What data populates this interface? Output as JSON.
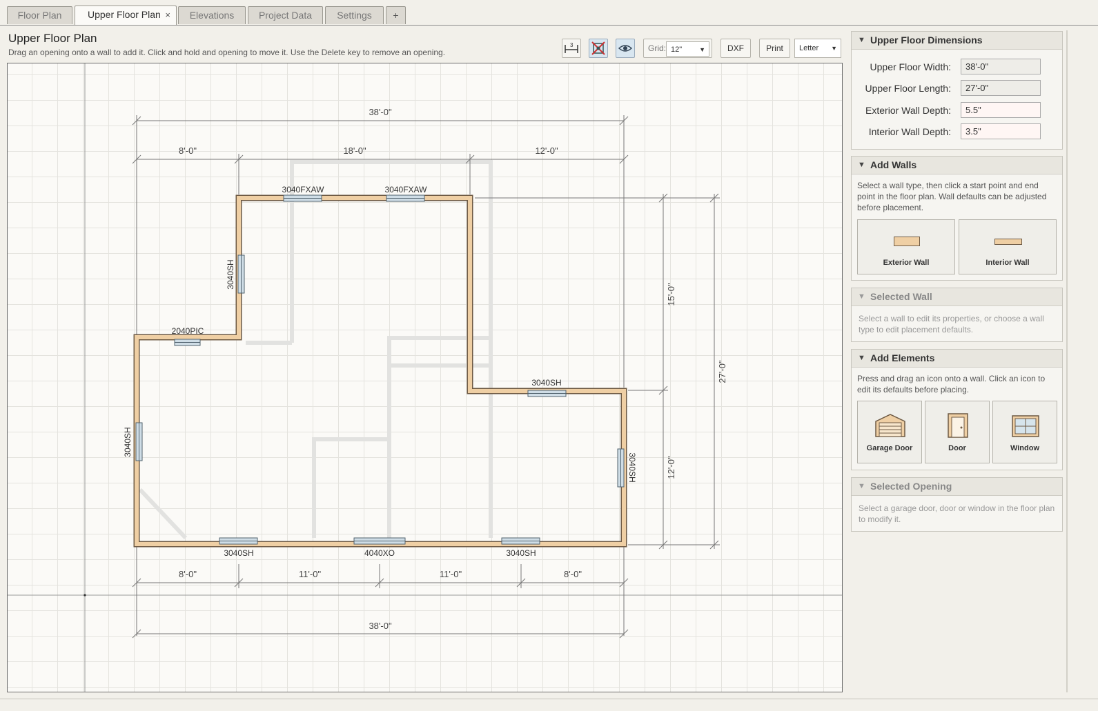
{
  "tabs": [
    {
      "label": "Floor Plan"
    },
    {
      "label": "Upper Floor Plan",
      "close": "×"
    },
    {
      "label": "Elevations"
    },
    {
      "label": "Project Data"
    },
    {
      "label": "Settings"
    },
    {
      "label": "+"
    }
  ],
  "header": {
    "title": "Upper Floor Plan",
    "instructions": "Drag an opening onto a wall to add it. Click and hold and opening to move it. Use the Delete key to remove an opening."
  },
  "toolbar": {
    "dimension_icon": "dimension-toggle-icon",
    "snap_icon": "snap-icon",
    "view_icon": "eye-icon",
    "grid_label": "Grid:",
    "grid_value": "12\"",
    "dxf_label": "DXF",
    "print_label": "Print",
    "paper_value": "Letter"
  },
  "plan": {
    "dimensions": {
      "top_overall": "38'-0\"",
      "top_left": "8'-0\"",
      "top_mid": "18'-0\"",
      "top_right": "12'-0\"",
      "bottom_overall": "38'-0\"",
      "bottom_1": "8'-0\"",
      "bottom_2": "11'-0\"",
      "bottom_3": "11'-0\"",
      "bottom_4": "8'-0\"",
      "right_upper": "15'-0\"",
      "right_lower": "12'-0\"",
      "right_overall": "27'-0\""
    },
    "openings": {
      "top_window_1": "3040FXAW",
      "top_window_2": "3040FXAW",
      "left_upper_window": "3040SH",
      "pic_window": "2040PIC",
      "left_lower_window": "3040SH",
      "step_window": "3040SH",
      "right_window": "3040SH",
      "bottom_window_1": "3040SH",
      "bottom_window_2": "4040XO",
      "bottom_window_3": "3040SH"
    }
  },
  "panels": {
    "dimensions": {
      "title": "Upper Floor Dimensions",
      "fields": [
        {
          "label": "Upper Floor Width:",
          "value": "38'-0\""
        },
        {
          "label": "Upper Floor Length:",
          "value": "27'-0\""
        },
        {
          "label": "Exterior Wall Depth:",
          "value": "5.5\""
        },
        {
          "label": "Interior Wall Depth:",
          "value": "3.5\""
        }
      ]
    },
    "add_walls": {
      "title": "Add Walls",
      "text": "Select a wall type, then click a start point and end point in the floor plan. Wall defaults can be adjusted before placement.",
      "exterior_label": "Exterior Wall",
      "interior_label": "Interior Wall"
    },
    "selected_wall": {
      "title": "Selected Wall",
      "text": "Select a wall to edit its properties, or choose a wall type to edit placement defaults."
    },
    "add_elements": {
      "title": "Add Elements",
      "text": "Press and drag an icon onto a wall. Click an icon to edit its defaults before placing.",
      "garage_label": "Garage Door",
      "door_label": "Door",
      "window_label": "Window"
    },
    "selected_opening": {
      "title": "Selected Opening",
      "text": "Select a garage door, door or window in the floor plan to modify it."
    }
  },
  "colors": {
    "wall_fill": "#efcfa4",
    "wall_stroke": "#6e5a44",
    "window_fill": "#cfdde6",
    "accent_button": "#d8e6f0"
  }
}
